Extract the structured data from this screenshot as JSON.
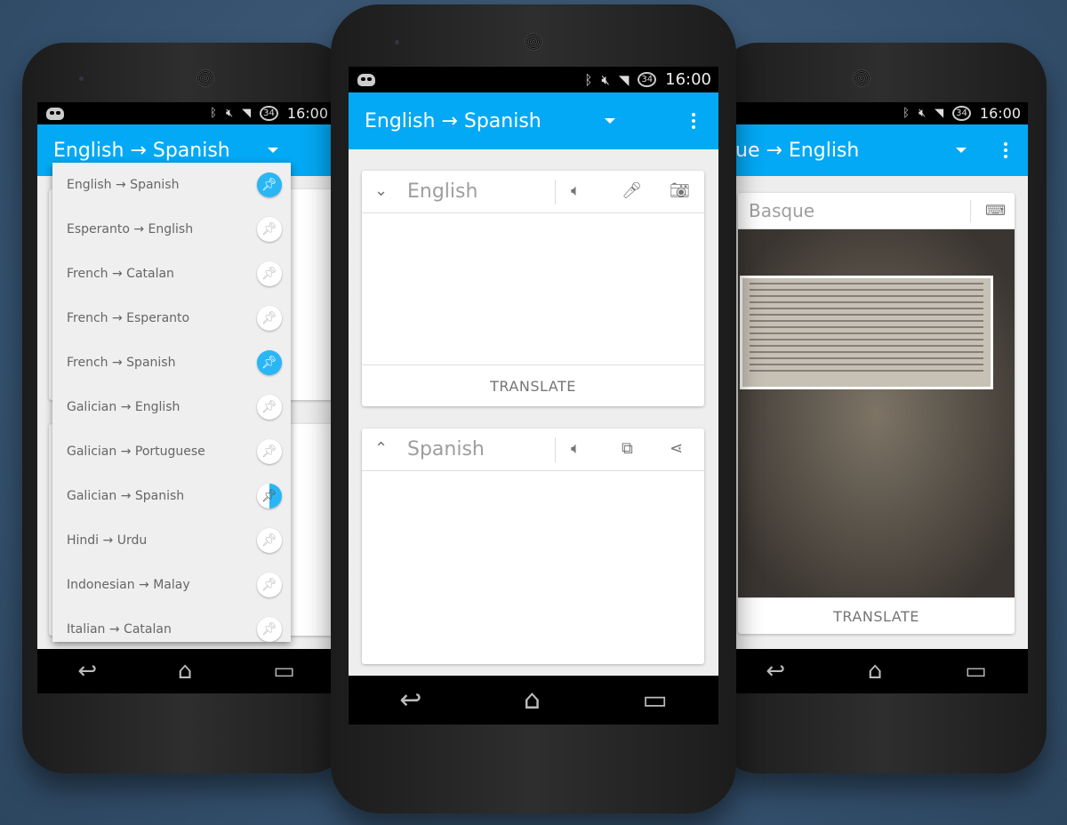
{
  "status_bar": {
    "time": "16:00",
    "battery": "34",
    "icons": [
      "cyanogen-robot-icon",
      "bluetooth-icon",
      "mute-icon",
      "wifi-icon",
      "signal-icon",
      "battery-icon"
    ]
  },
  "colors": {
    "accent": "#03a9f4",
    "pin_active": "#29b6f6",
    "background": "#34506d"
  },
  "left_phone": {
    "title": "English → Spanish",
    "dropdown": [
      {
        "label": "English → Spanish",
        "pin": "pinned"
      },
      {
        "label": "Esperanto → English",
        "pin": "unpinned"
      },
      {
        "label": "French → Catalan",
        "pin": "unpinned"
      },
      {
        "label": "French → Esperanto",
        "pin": "unpinned"
      },
      {
        "label": "French → Spanish",
        "pin": "pinned"
      },
      {
        "label": "Galician → English",
        "pin": "unpinned"
      },
      {
        "label": "Galician → Portuguese",
        "pin": "unpinned"
      },
      {
        "label": "Galician → Spanish",
        "pin": "partial"
      },
      {
        "label": "Hindi → Urdu",
        "pin": "unpinned"
      },
      {
        "label": "Indonesian → Malay",
        "pin": "unpinned"
      },
      {
        "label": "Italian → Catalan",
        "pin": "unpinned"
      }
    ]
  },
  "center_phone": {
    "title": "English → Spanish",
    "source": {
      "language": "English",
      "translate_label": "TRANSLATE"
    },
    "target": {
      "language": "Spanish"
    }
  },
  "right_phone": {
    "title": "Basque → English",
    "source": {
      "language": "Basque",
      "translate_label": "TRANSLATE"
    }
  }
}
